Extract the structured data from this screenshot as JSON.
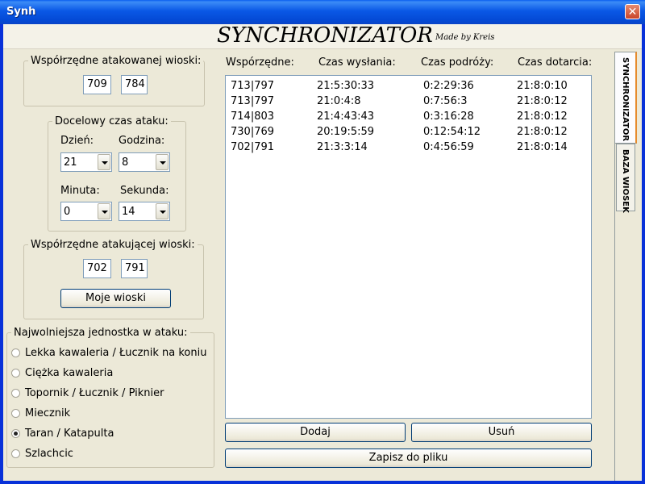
{
  "window": {
    "title": "Synh",
    "close_glyph": "✕"
  },
  "header": {
    "app_title": "SYNCHRONIZATOR",
    "made_by": "Made by Kreis"
  },
  "target_coords": {
    "legend": "Współrzędne atakowanej wioski:",
    "x": "709",
    "y": "784"
  },
  "attack_time": {
    "legend": "Docelowy czas ataku:",
    "day_label": "Dzień:",
    "day_value": "21",
    "hour_label": "Godzina:",
    "hour_value": "8",
    "minute_label": "Minuta:",
    "minute_value": "0",
    "second_label": "Sekunda:",
    "second_value": "14"
  },
  "attacker_coords": {
    "legend": "Współrzędne atakującej wioski:",
    "x": "702",
    "y": "791",
    "my_villages_button": "Moje wioski"
  },
  "unit": {
    "legend": "Najwolniejsza jednostka w ataku:",
    "options": [
      {
        "label": "Lekka kawaleria / Łucznik na koniu",
        "selected": false
      },
      {
        "label": "Ciężka kawaleria",
        "selected": false
      },
      {
        "label": "Topornik / Łucznik / Piknier",
        "selected": false
      },
      {
        "label": "Miecznik",
        "selected": false
      },
      {
        "label": "Taran / Katapulta",
        "selected": true
      },
      {
        "label": "Szlachcic",
        "selected": false
      }
    ]
  },
  "table": {
    "headers": [
      "Wspórzędne:",
      "Czas wysłania:",
      "Czas podróży:",
      "Czas dotarcia:"
    ],
    "rows": [
      [
        "713|797",
        "21:5:30:33",
        "0:2:29:36",
        "21:8:0:10"
      ],
      [
        "713|797",
        "21:0:4:8",
        "0:7:56:3",
        "21:8:0:12"
      ],
      [
        "714|803",
        "21:4:43:43",
        "0:3:16:28",
        "21:8:0:12"
      ],
      [
        "730|769",
        "20:19:5:59",
        "0:12:54:12",
        "21:8:0:12"
      ],
      [
        "702|791",
        "21:3:3:14",
        "0:4:56:59",
        "21:8:0:14"
      ]
    ]
  },
  "buttons": {
    "add": "Dodaj",
    "remove": "Usuń",
    "save": "Zapisz do pliku"
  },
  "tabs": [
    {
      "label": "SYNCHRONIZATOR",
      "active": true
    },
    {
      "label": "BAZA WIOSEK",
      "active": false
    }
  ]
}
